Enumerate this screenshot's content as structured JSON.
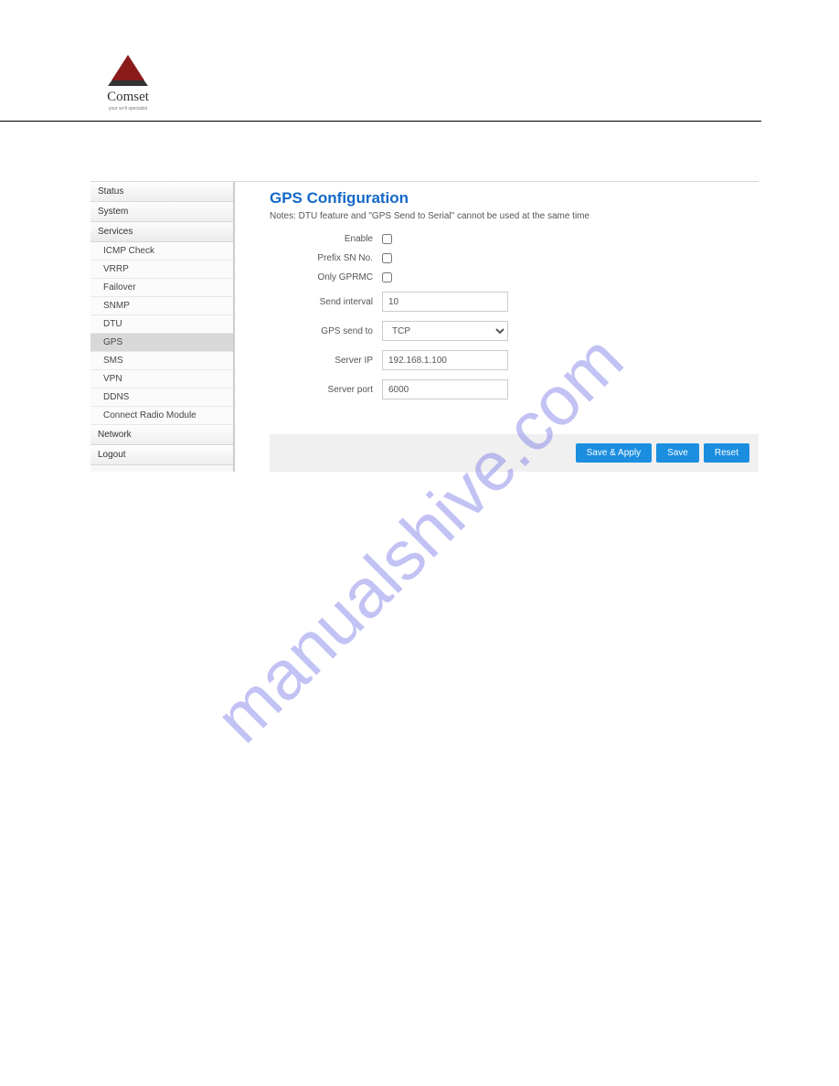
{
  "header": {
    "logo_text": "Comset",
    "logo_subtext": "your wi-fi specialist"
  },
  "sidebar": {
    "items": [
      {
        "label": "Status",
        "type": "top"
      },
      {
        "label": "System",
        "type": "top"
      },
      {
        "label": "Services",
        "type": "top",
        "expanded": true
      },
      {
        "label": "ICMP Check",
        "type": "sub"
      },
      {
        "label": "VRRP",
        "type": "sub"
      },
      {
        "label": "Failover",
        "type": "sub"
      },
      {
        "label": "SNMP",
        "type": "sub"
      },
      {
        "label": "DTU",
        "type": "sub"
      },
      {
        "label": "GPS",
        "type": "sub",
        "active": true
      },
      {
        "label": "SMS",
        "type": "sub"
      },
      {
        "label": "VPN",
        "type": "sub"
      },
      {
        "label": "DDNS",
        "type": "sub"
      },
      {
        "label": "Connect Radio Module",
        "type": "sub"
      },
      {
        "label": "Network",
        "type": "top"
      },
      {
        "label": "Logout",
        "type": "top"
      }
    ]
  },
  "main": {
    "title": "GPS Configuration",
    "notes": "Notes: DTU feature and \"GPS Send to Serial\" cannot be used at the same time",
    "fields": {
      "enable_label": "Enable",
      "prefix_label": "Prefix SN No.",
      "gprmc_label": "Only GPRMC",
      "interval_label": "Send interval",
      "interval_value": "10",
      "sendto_label": "GPS send to",
      "sendto_value": "TCP",
      "serverip_label": "Server IP",
      "serverip_value": "192.168.1.100",
      "serverport_label": "Server port",
      "serverport_value": "6000"
    },
    "buttons": {
      "save_apply": "Save & Apply",
      "save": "Save",
      "reset": "Reset"
    }
  },
  "watermark": "manualshive.com"
}
